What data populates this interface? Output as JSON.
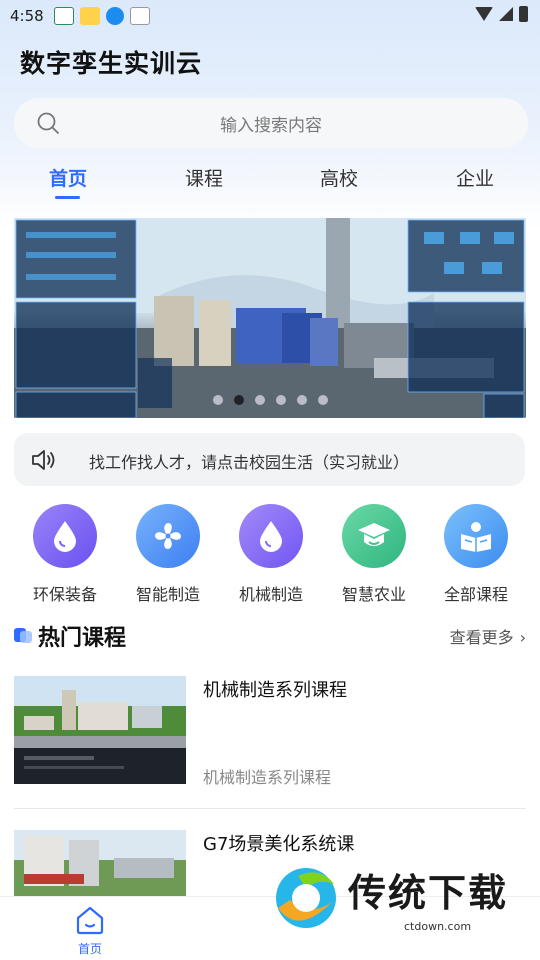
{
  "status_bar": {
    "time": "4:58",
    "icons": [
      "app-notification-icon",
      "app-notification-icon",
      "download-icon",
      "app-notification-icon",
      "wifi-icon",
      "signal-icon",
      "battery-icon"
    ]
  },
  "header": {
    "title": "数字孪生实训云"
  },
  "search": {
    "placeholder": "输入搜索内容",
    "icon": "search-icon"
  },
  "tabs": [
    {
      "label": "首页",
      "active": true
    },
    {
      "label": "课程",
      "active": false
    },
    {
      "label": "高校",
      "active": false
    },
    {
      "label": "企业",
      "active": false
    }
  ],
  "banner": {
    "slide_count": 6,
    "active_index": 1
  },
  "notice": {
    "icon": "speaker-icon",
    "text": "找工作找人才，请点击校园生活（实习就业）"
  },
  "categories": [
    {
      "label": "环保装备",
      "icon": "water-drop-icon",
      "color": "#7b63f5"
    },
    {
      "label": "智能制造",
      "icon": "fan-icon",
      "color": "#4f93f5"
    },
    {
      "label": "机械制造",
      "icon": "water-drop-icon",
      "color": "#8a6cf6"
    },
    {
      "label": "智慧农业",
      "icon": "graduation-cap-icon",
      "color": "#3ec58f"
    },
    {
      "label": "全部课程",
      "icon": "reading-icon",
      "color": "#4fa3f5"
    }
  ],
  "hot_courses": {
    "title": "热门课程",
    "more": "查看更多",
    "items": [
      {
        "title": "机械制造系列课程",
        "subtitle": "机械制造系列课程"
      },
      {
        "title": "G7场景美化系统课",
        "subtitle": ""
      }
    ]
  },
  "bottom_nav": {
    "items": [
      {
        "label": "首页",
        "icon": "home-icon",
        "active": true
      }
    ]
  },
  "watermark": {
    "text": "传统下载",
    "url": "ctdown.com"
  },
  "colors": {
    "accent": "#2f6bff"
  }
}
